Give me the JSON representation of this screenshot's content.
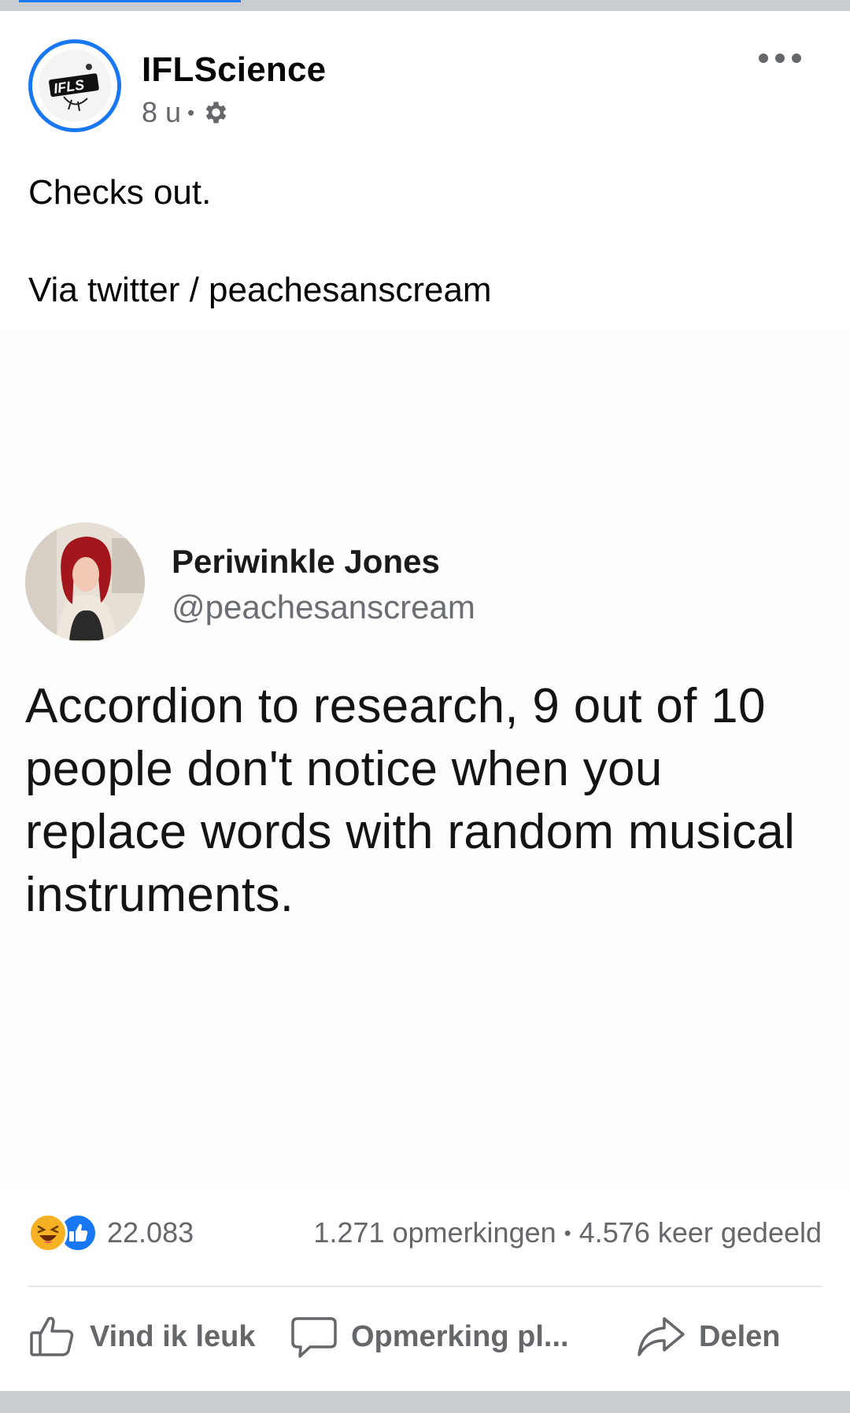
{
  "post": {
    "page_name": "IFLScience",
    "avatar_text": "IFLS",
    "time": "8 u",
    "separator": "•",
    "text_lines": [
      "Checks out.",
      "Via twitter / peachesanscream"
    ]
  },
  "tweet": {
    "name": "Periwinkle Jones",
    "handle": "@peachesanscream",
    "body": "Accordion to research, 9 out of 10 people don't notice when you replace words with random musical instruments."
  },
  "stats": {
    "reaction_count": "22.083",
    "comments": "1.271 opmerkingen",
    "separator": "•",
    "shares": "4.576 keer gedeeld"
  },
  "actions": {
    "like": "Vind ik leuk",
    "comment": "Opmerking pl...",
    "share": "Delen"
  },
  "icons": {
    "privacy": "gear-icon",
    "more": "more-options-icon",
    "reaction_1": "haha-reaction-icon",
    "reaction_2": "like-reaction-icon",
    "like_action": "thumbs-up-icon",
    "comment_action": "speech-bubble-icon",
    "share_action": "share-arrow-icon"
  },
  "colors": {
    "accent": "#1877f2",
    "text_primary": "#050505",
    "text_secondary": "#65676b",
    "haha_reaction": "#f7b125"
  }
}
